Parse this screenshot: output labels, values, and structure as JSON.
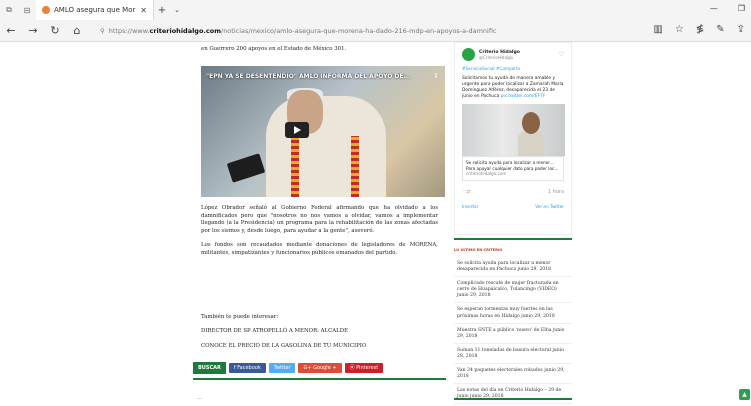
{
  "browser": {
    "tab_title": "AMLO asegura que Mor",
    "url_prefix": "https://www.",
    "url_domain": "criteriohidalgo.com",
    "url_path": "/noticias/mexico/amlo-asegura-que-morena-ha-dado-216-mdp-en-apoyos-a-damnific"
  },
  "icons": {
    "tabs_aside": "⧉",
    "tab_preview": "⊟",
    "close": "✕",
    "new_tab": "+",
    "tab_list": "⌄",
    "minimize": "—",
    "restore": "❐",
    "back": "←",
    "forward": "→",
    "refresh": "↻",
    "home": "⌂",
    "lock": "⚲",
    "reading_view": "▥",
    "favorite": "☆",
    "favorites_hub": "≸",
    "notes": "✎",
    "share": "⇪",
    "play": "▶",
    "bird": "♡",
    "like": "♡",
    "reply": "⇄",
    "scroll_top": "▲"
  },
  "article": {
    "top_line": "en Guerrero 200 apoyos en el Estado de México 301.",
    "video_title": "\"EPN YA SE DESENTENDIÓ\" AMLO INFORMA DEL APOYO DE...",
    "paragraph1": "López Obrador señaló al Gobierno Federal afirmando que ha olvidado a los damnificados pero que \"nosotros no nos vamos a olvidar, vamos a implementar llegando (a la Presidencia) un programa para la rehabilitación de las zonas afectadas por los sismos y, desde luego, para ayudar a la gente\", aseveró.",
    "paragraph2": "Los fondos son recaudados mediante donaciones de legisladores de MORENA, militantes, simpatizantes y funcionarios públicos emanados del partido.",
    "also_label": "También te puede interesar:",
    "related1": "DIRECTOR DE SP ATROPELLÓ A MENOR: ALCALDE",
    "related2": "CONOCE EL PRECIO DE LA GASOLINA DE TU MUNICIPIO",
    "more": "..."
  },
  "share": {
    "buscar": "BUSCAR",
    "facebook": "f  Facebook",
    "twitter": "Twitter",
    "google": "G+ Google +",
    "pinterest": "⦿ Pinterest",
    "colors": {
      "facebook": "#3b5998",
      "twitter": "#55acee",
      "google": "#dd4b39",
      "pinterest": "#cb2027",
      "brand_green": "#1c7a3b"
    }
  },
  "tweet": {
    "name": "Criterio Hidalgo",
    "handle": "@CriterioHidalgo",
    "hashtag": "#ServicioSocial #Compartir",
    "text": "Solicitamos tu ayuda de manera amable y urgente para poder localizar a Zamarah María Domínguez Alférez, desaparecida el 23 de junio en Pachuca",
    "link": "pic.twitter.com/EF7F",
    "card_title": "Se solicita ayuda para localizar a menor...",
    "card_desc": "Para apoyar cualquier dato para poder loc...",
    "card_domain": "criteriohidalgo.com",
    "time": "1 hora",
    "embed": "Insertar",
    "view": "Ver en Twitter"
  },
  "sidebar": {
    "news_header": "LO ÚLTIMO EN CRITERIO",
    "items": [
      "Se solicita ayuda para localizar a menor desaparecida en Pachuca junio 29, 2018",
      "Complicado rescate de mujer fracturada en cerro de Huapalcalco, Tulancingo (VIDEO) junio 29, 2018",
      "Se esperan tormentas muy fuertes en las próximas horas en Hidalgo junio 29, 2018",
      "Muestra SNTE a público 'nuevo' de Elba junio 29, 2018",
      "Suman 11 toneladas de basura electoral junio 29, 2018",
      "Van 34 paquetes electorales robados junio 29, 2018",
      "Las notas del día en Criterio Hidalgo – 29 de junio junio 29, 2018"
    ]
  }
}
